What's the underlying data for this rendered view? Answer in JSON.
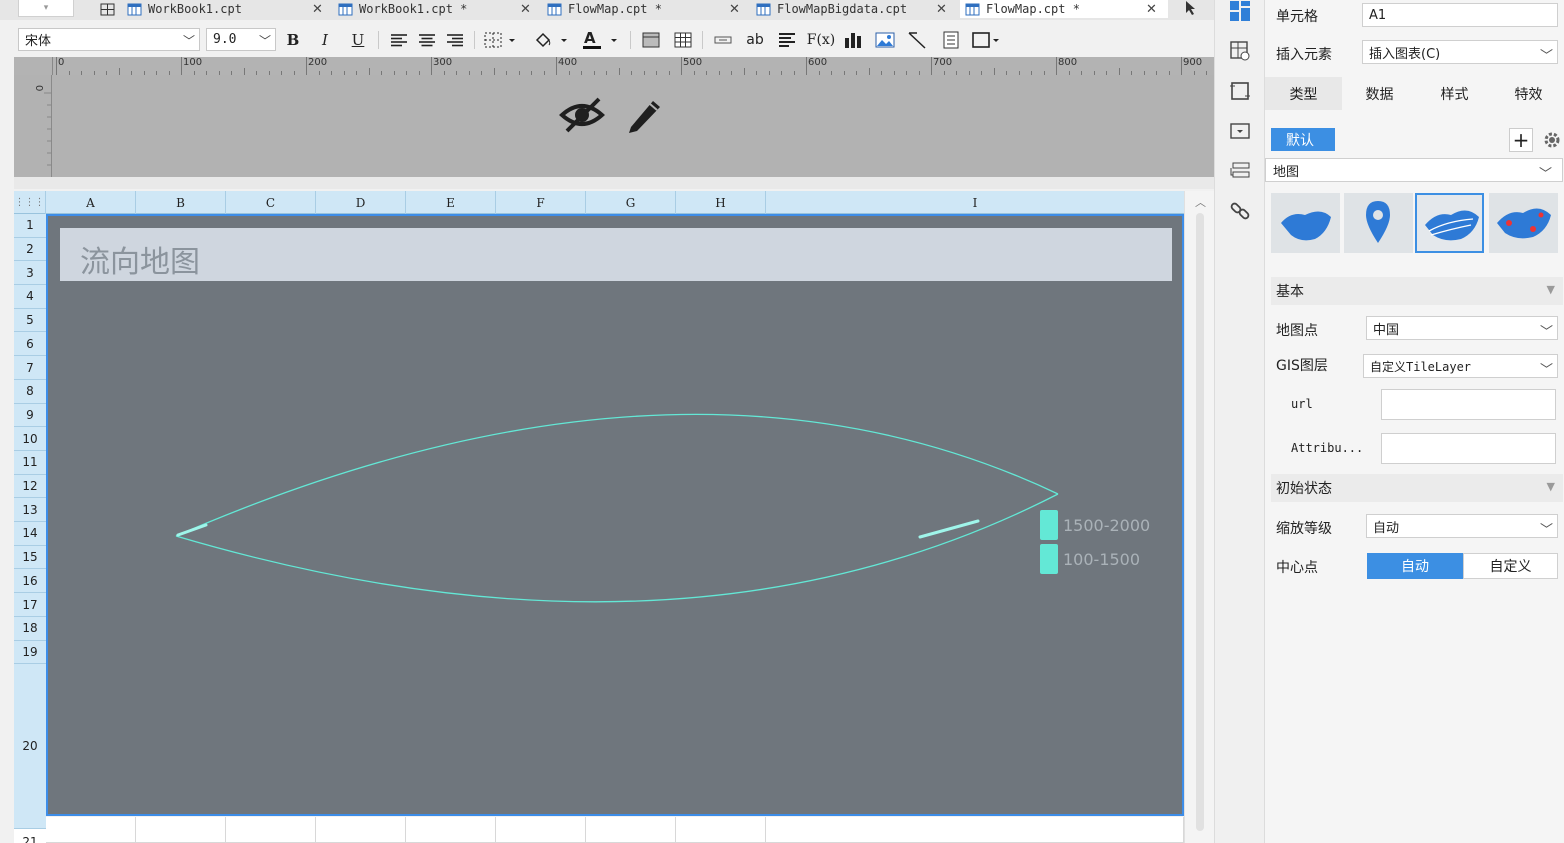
{
  "tabs": [
    {
      "label": "WorkBook1.cpt",
      "closable": true,
      "active": false
    },
    {
      "label": "WorkBook1.cpt *",
      "closable": true,
      "active": false
    },
    {
      "label": "FlowMap.cpt *",
      "closable": true,
      "active": false
    },
    {
      "label": "FlowMapBigdata.cpt",
      "closable": true,
      "active": false
    },
    {
      "label": "FlowMap.cpt *",
      "closable": true,
      "active": true
    }
  ],
  "toolbar": {
    "font_family": "宋体",
    "font_size": "9.0",
    "bold": "B",
    "italic": "I",
    "underline": "U",
    "text_ab": "ab",
    "formula": "F(x)"
  },
  "ruler": {
    "marks": [
      "0",
      "100",
      "200",
      "300",
      "400",
      "500",
      "600",
      "700",
      "800",
      "900"
    ]
  },
  "grid": {
    "columns": [
      "A",
      "B",
      "C",
      "D",
      "E",
      "F",
      "G",
      "H",
      "I"
    ],
    "rows": [
      "1",
      "2",
      "3",
      "4",
      "5",
      "6",
      "7",
      "8",
      "9",
      "10",
      "11",
      "12",
      "13",
      "14",
      "15",
      "16",
      "17",
      "18",
      "19",
      "20",
      "21"
    ]
  },
  "chart": {
    "title": "流向地图",
    "legend": [
      {
        "label": "1500-2000",
        "color": "#63e8d6"
      },
      {
        "label": "100-1500",
        "color": "#63e8d6"
      }
    ],
    "background": "#6f767d",
    "flow_color": "#63e8d6"
  },
  "panel": {
    "cell_label": "单元格",
    "cell_value": "A1",
    "insert_label": "插入元素",
    "insert_value": "插入图表(C)",
    "tabs": [
      "类型",
      "数据",
      "样式",
      "特效"
    ],
    "style_chip": "默认",
    "chart_type": "地图",
    "section_basic": "基本",
    "map_point_label": "地图点",
    "map_point_value": "中国",
    "gis_label": "GIS图层",
    "gis_value": "自定义TileLayer",
    "url_label": "url",
    "url_value": "",
    "attrib_label": "Attribu...",
    "attrib_value": "",
    "section_initial": "初始状态",
    "zoom_label": "缩放等级",
    "zoom_value": "自动",
    "center_label": "中心点",
    "center_auto": "自动",
    "center_custom": "自定义"
  }
}
